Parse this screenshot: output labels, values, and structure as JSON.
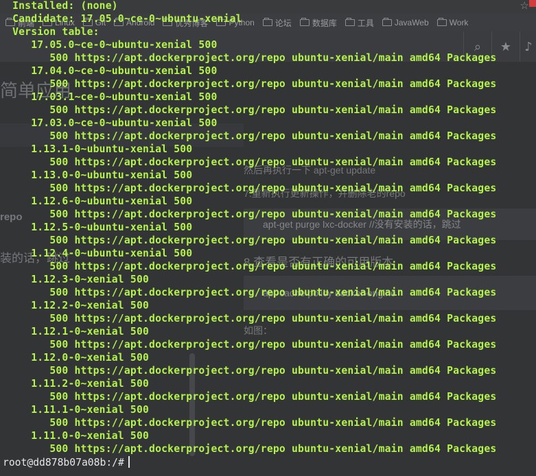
{
  "browser": {
    "bookmarks": [
      "前端",
      "Linux",
      "Git",
      "Android",
      "优秀博客",
      "Python",
      "论坛",
      "数据库",
      "工具",
      "JavaWeb",
      "Work"
    ],
    "article": {
      "heading": "简单应用",
      "step_update": "然后再执行一下 apt-get update",
      "step7": "7.重新执行更新操作，并删除老的repo",
      "purge_cmd": "apt-get purge lxc-docker //没有安装的话，跳过",
      "left_repo": "repo",
      "left_text": "装的话，跳过",
      "step8": "8.查看是否有正确的可用版本",
      "policy_cmd": "apt-cache policy docker-engine",
      "figure_label": "如图："
    }
  },
  "terminal": {
    "lines": [
      "  Installed: (none)",
      "  Candidate: 17.05.0~ce-0~ubuntu-xenial",
      "  Version table:",
      "     17.05.0~ce-0~ubuntu-xenial 500",
      "        500 https://apt.dockerproject.org/repo ubuntu-xenial/main amd64 Packages",
      "     17.04.0~ce-0~ubuntu-xenial 500",
      "        500 https://apt.dockerproject.org/repo ubuntu-xenial/main amd64 Packages",
      "     17.03.1~ce-0~ubuntu-xenial 500",
      "        500 https://apt.dockerproject.org/repo ubuntu-xenial/main amd64 Packages",
      "     17.03.0~ce-0~ubuntu-xenial 500",
      "        500 https://apt.dockerproject.org/repo ubuntu-xenial/main amd64 Packages",
      "     1.13.1-0~ubuntu-xenial 500",
      "        500 https://apt.dockerproject.org/repo ubuntu-xenial/main amd64 Packages",
      "     1.13.0-0~ubuntu-xenial 500",
      "        500 https://apt.dockerproject.org/repo ubuntu-xenial/main amd64 Packages",
      "     1.12.6-0~ubuntu-xenial 500",
      "        500 https://apt.dockerproject.org/repo ubuntu-xenial/main amd64 Packages",
      "     1.12.5-0~ubuntu-xenial 500",
      "        500 https://apt.dockerproject.org/repo ubuntu-xenial/main amd64 Packages",
      "     1.12.4-0~ubuntu-xenial 500",
      "        500 https://apt.dockerproject.org/repo ubuntu-xenial/main amd64 Packages",
      "     1.12.3-0~xenial 500",
      "        500 https://apt.dockerproject.org/repo ubuntu-xenial/main amd64 Packages",
      "     1.12.2-0~xenial 500",
      "        500 https://apt.dockerproject.org/repo ubuntu-xenial/main amd64 Packages",
      "     1.12.1-0~xenial 500",
      "        500 https://apt.dockerproject.org/repo ubuntu-xenial/main amd64 Packages",
      "     1.12.0-0~xenial 500",
      "        500 https://apt.dockerproject.org/repo ubuntu-xenial/main amd64 Packages",
      "     1.11.2-0~xenial 500",
      "        500 https://apt.dockerproject.org/repo ubuntu-xenial/main amd64 Packages",
      "     1.11.1-0~xenial 500",
      "        500 https://apt.dockerproject.org/repo ubuntu-xenial/main amd64 Packages",
      "     1.11.0-0~xenial 500",
      "        500 https://apt.dockerproject.org/repo ubuntu-xenial/main amd64 Packages"
    ],
    "prompt": "root@dd878b07a08b:/#"
  },
  "colors": {
    "terminal_text": "#b4f24c",
    "terminal_bg": "#2b2d2f",
    "prompt": "#e6e6e6"
  },
  "icons": [
    "folder-icon",
    "search-icon",
    "star-icon",
    "bell-icon",
    "cursor-icon"
  ]
}
